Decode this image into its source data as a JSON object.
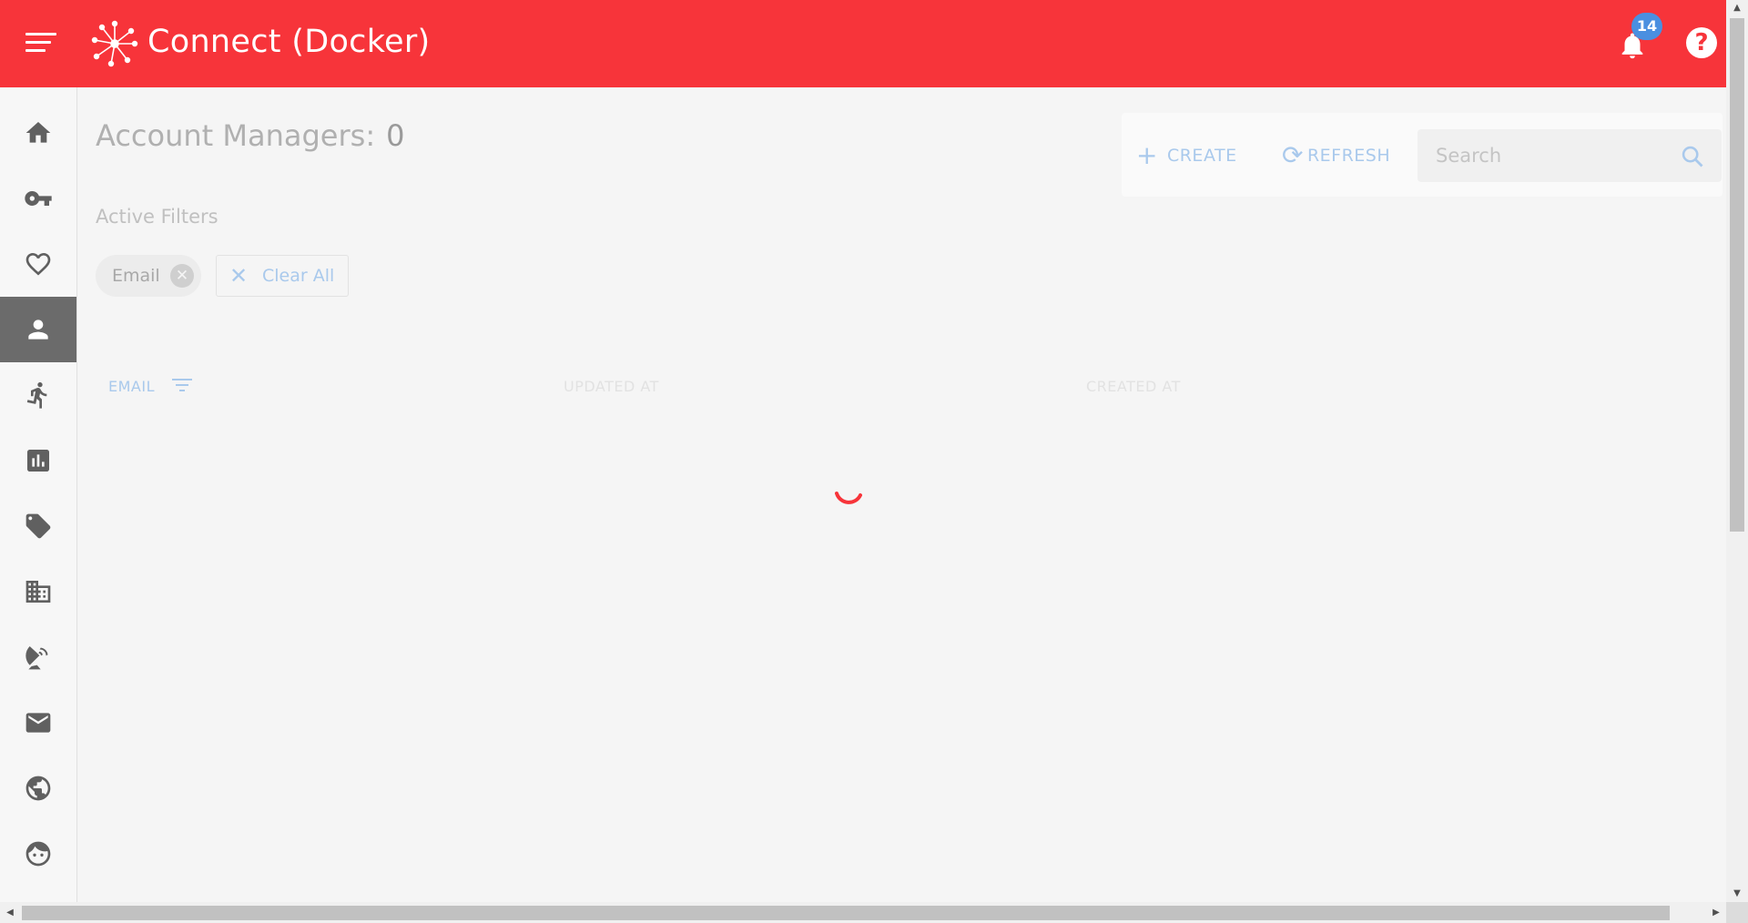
{
  "app": {
    "title": "Connect (Docker)",
    "notification_count": "14",
    "help_label": "?"
  },
  "sidebar": {
    "items": [
      {
        "name": "home",
        "icon": "home-icon",
        "active": false
      },
      {
        "name": "keys",
        "icon": "key-icon",
        "active": false
      },
      {
        "name": "favorites",
        "icon": "heart-icon",
        "active": false
      },
      {
        "name": "account-managers",
        "icon": "person-icon",
        "active": true
      },
      {
        "name": "activity",
        "icon": "running-person-icon",
        "active": false
      },
      {
        "name": "reports",
        "icon": "bar-chart-icon",
        "active": false
      },
      {
        "name": "tags",
        "icon": "tag-icon",
        "active": false
      },
      {
        "name": "organizations",
        "icon": "building-icon",
        "active": false
      },
      {
        "name": "broadcast",
        "icon": "satellite-dish-icon",
        "active": false
      },
      {
        "name": "mail",
        "icon": "mail-icon",
        "active": false
      },
      {
        "name": "global",
        "icon": "globe-icon",
        "active": false
      },
      {
        "name": "users",
        "icon": "face-icon",
        "active": false
      }
    ]
  },
  "main": {
    "title": "Account Managers:",
    "count": "0",
    "toolbar": {
      "create_label": "CREATE",
      "refresh_label": "REFRESH",
      "search_placeholder": "Search"
    },
    "filters": {
      "label": "Active Filters",
      "chips": [
        {
          "label": "Email"
        }
      ],
      "clear_all_label": "Clear All"
    },
    "table": {
      "columns": [
        "EMAIL",
        "UPDATED AT",
        "CREATED AT"
      ]
    }
  },
  "colors": {
    "accent": "#f7343a",
    "badge": "#4a8fe0",
    "link": "#a9c9ec"
  }
}
